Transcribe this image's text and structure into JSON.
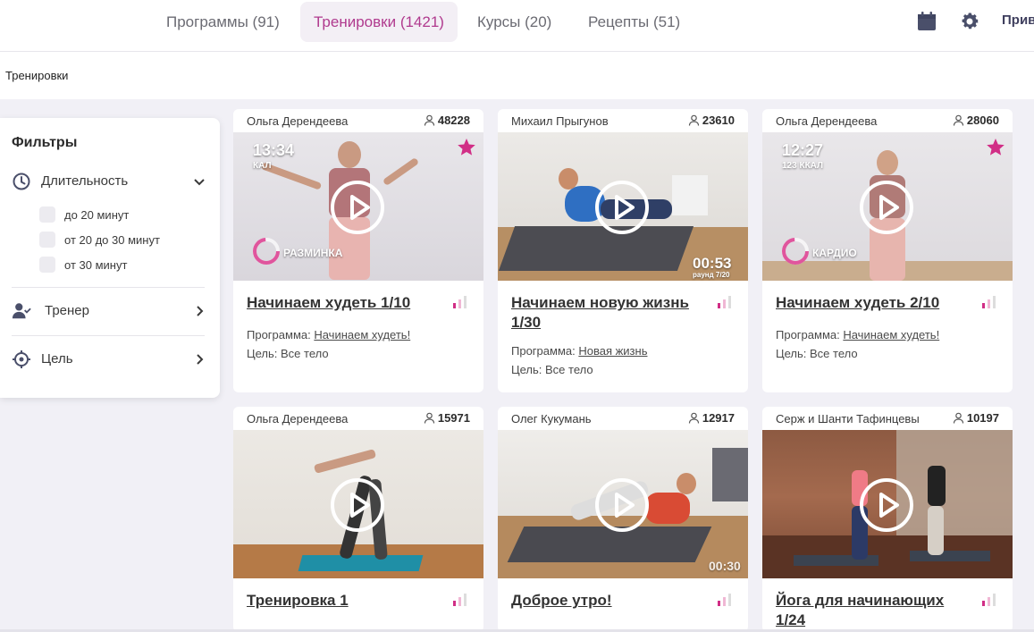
{
  "nav": {
    "tabs": [
      {
        "label": "Программы (91)"
      },
      {
        "label": "Тренировки (1421)"
      },
      {
        "label": "Курсы (20)"
      },
      {
        "label": "Рецепты (51)"
      }
    ],
    "active_tab": "Тренировки (1421)",
    "cut_text": "Прив",
    "icons": [
      "calendar-icon",
      "gear-icon"
    ]
  },
  "breadcrumb": {
    "label": "Тренировки"
  },
  "filters": {
    "title": "Фильтры",
    "duration": {
      "label": "Длительность",
      "options": [
        {
          "label": "до 20 минут"
        },
        {
          "label": "от 20 до 30 минут"
        },
        {
          "label": "от 30 минут"
        }
      ]
    },
    "trainer": {
      "label": "Тренер"
    },
    "goal": {
      "label": "Цель"
    }
  },
  "colors": {
    "accent": "#b03a8e",
    "pink": "#e0559d",
    "bg": "#f1f0f6"
  },
  "cards": [
    {
      "author": "Ольга Дерендеева",
      "views": "48228",
      "title": "Начинаем худеть 1/10",
      "program_prefix": "Программа: ",
      "program": "Начинаем худеть!",
      "goal": "Цель: Все тело",
      "overlay_time": "13:34",
      "overlay_kcal": "КАЛ",
      "overlay_tag": "РАЗМИНКА"
    },
    {
      "author": "Михаил Прыгунов",
      "views": "23610",
      "title": "Начинаем новую жизнь 1/30",
      "program_prefix": "Программа: ",
      "program": "Новая жизнь",
      "goal": "Цель: Все тело",
      "overlay_time": "00:53",
      "overlay_round": "раунд 7/20"
    },
    {
      "author": "Ольга Дерендеева",
      "views": "28060",
      "title": "Начинаем худеть 2/10",
      "program_prefix": "Программа: ",
      "program": "Начинаем худеть!",
      "goal": "Цель: Все тело",
      "overlay_time": "12:27",
      "overlay_kcal": "123 ККАЛ",
      "overlay_tag": "КАРДИО"
    },
    {
      "author": "Ольга Дерендеева",
      "views": "15971",
      "title": "Тренировка 1"
    },
    {
      "author": "Олег Кукумань",
      "views": "12917",
      "title": "Доброе утро!",
      "overlay_time": "00:30"
    },
    {
      "author": "Серж и Шанти Тафинцевы",
      "views": "10197",
      "title": "Йога для начинающих 1/24"
    }
  ]
}
